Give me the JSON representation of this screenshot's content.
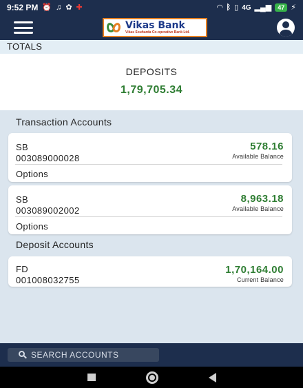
{
  "status_bar": {
    "time": "9:52 PM",
    "battery": "47",
    "network": "4G"
  },
  "header": {
    "logo_name": "Vikas Bank",
    "logo_subtitle": "Vikas Souharda Co-operative Bank Ltd."
  },
  "totals": {
    "label": "TOTALS",
    "deposits_label": "DEPOSITS",
    "deposits_value": "1,79,705.34"
  },
  "sections": {
    "transaction_title": "Transaction Accounts",
    "deposit_title": "Deposit Accounts"
  },
  "transaction_accounts": [
    {
      "type": "SB",
      "number": "003089000028",
      "amount": "578.16",
      "caption": "Available Balance",
      "options": "Options"
    },
    {
      "type": "SB",
      "number": "003089002002",
      "amount": "8,963.18",
      "caption": "Available Balance",
      "options": "Options"
    }
  ],
  "deposit_accounts": [
    {
      "type": "FD",
      "number": "001008032755",
      "amount": "1,70,164.00",
      "caption": "Current Balance"
    }
  ],
  "bottom": {
    "search_label": "SEARCH ACCOUNTS"
  },
  "colors": {
    "primary": "#1d2e4d",
    "amount_green": "#2e7d32",
    "logo_orange": "#e57f20"
  }
}
